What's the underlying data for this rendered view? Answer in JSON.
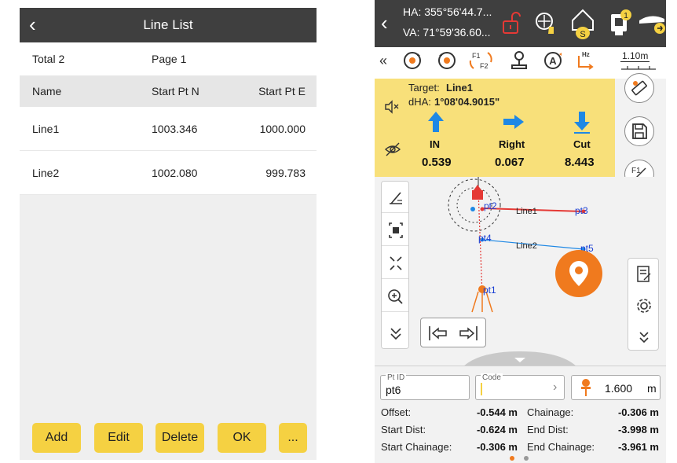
{
  "line_list": {
    "title": "Line List",
    "total": "Total 2",
    "page": "Page 1",
    "columns": [
      "Name",
      "Start Pt N",
      "Start Pt E"
    ],
    "rows": [
      {
        "name": "Line1",
        "n": "1003.346",
        "e": "1000.000"
      },
      {
        "name": "Line2",
        "n": "1002.080",
        "e": "999.783"
      }
    ],
    "buttons": {
      "add": "Add",
      "edit": "Edit",
      "delete": "Delete",
      "ok": "OK",
      "more": "..."
    }
  },
  "stakeout": {
    "ha": "HA: 355°56'44.7...",
    "va": "VA: 71°59'36.60...",
    "badge_s": "S",
    "badge_1": "1",
    "f1": "F1",
    "f2": "F2",
    "hz": "Hz",
    "a": "A",
    "target_height": "1.10m",
    "target_label": "Target: ",
    "target_name": "Line1",
    "dha_label": "dHA: ",
    "dha_value": "1°08'04.9015\"",
    "directions": [
      {
        "label": "IN",
        "value": "0.539"
      },
      {
        "label": "Right",
        "value": "0.067"
      },
      {
        "label": "Cut",
        "value": "8.443"
      }
    ],
    "map": {
      "points": [
        "pt2",
        "pt3",
        "pt4",
        "pt5",
        "pt1"
      ],
      "lines": [
        "Line1",
        "Line2"
      ]
    },
    "pt_id_label": "Pt ID",
    "pt_id_value": "pt6",
    "code_label": "Code",
    "instrument_height": "1.600",
    "unit": "m",
    "stats": {
      "offset_label": "Offset:",
      "offset_value": "-0.544 m",
      "chainage_label": "Chainage:",
      "chainage_value": "-0.306 m",
      "start_dist_label": "Start Dist:",
      "start_dist_value": "-0.624 m",
      "end_dist_label": "End Dist:",
      "end_dist_value": "-3.998 m",
      "start_chainage_label": "Start Chainage:",
      "start_chainage_value": "-0.306 m",
      "end_chainage_label": "End Chainage:",
      "end_chainage_value": "-3.961 m"
    },
    "colors": {
      "accent": "#f5d142",
      "orange": "#f07a1e",
      "blue_arrow": "#1e88e5",
      "red": "#e53935"
    }
  }
}
